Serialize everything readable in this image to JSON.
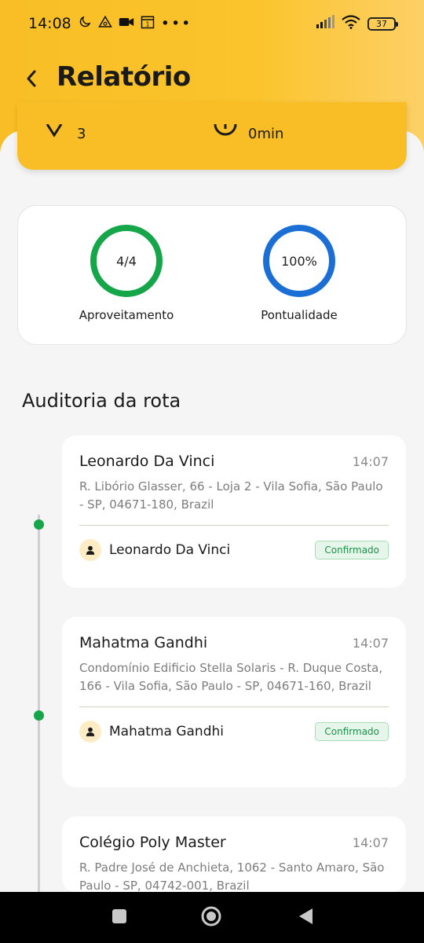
{
  "status": {
    "time": "14:08",
    "battery": "37",
    "icons": [
      "moon-icon",
      "triangle-icon",
      "camera-icon",
      "calendar-icon",
      "more-icon",
      "signal-icon",
      "wifi-icon",
      "battery-icon"
    ]
  },
  "header": {
    "title": "Relatório",
    "back_icon": "chevron-left-icon"
  },
  "summary": {
    "stops_count": "3",
    "delay": "0min"
  },
  "metrics": {
    "aproveitamento": {
      "value": "4/4",
      "label": "Aproveitamento",
      "color": "#15a64a"
    },
    "pontualidade": {
      "value": "100%",
      "label": "Pontualidade",
      "color": "#1b6fd4"
    }
  },
  "audit": {
    "title": "Auditoria da rota",
    "stops": [
      {
        "name": "Leonardo Da Vinci",
        "time": "14:07",
        "address": "R. Libório Glasser, 66 - Loja 2 - Vila Sofia, São Paulo - SP, 04671-180, Brazil",
        "person": "Leonardo Da Vinci",
        "status": "Confirmado"
      },
      {
        "name": "Mahatma Gandhi",
        "time": "14:07",
        "address": "Condomínio Edificio Stella Solaris - R. Duque Costa, 166 - Vila Sofia, São Paulo - SP, 04671-160, Brazil",
        "person": "Mahatma Gandhi",
        "status": "Confirmado"
      },
      {
        "name": "Colégio Poly Master",
        "time": "14:07",
        "address": "R. Padre José de Anchieta, 1062 - Santo Amaro, São Paulo - SP, 04742-001, Brazil"
      }
    ]
  },
  "colors": {
    "accent": "#f9be25",
    "confirmed": "#1f8f4a"
  }
}
